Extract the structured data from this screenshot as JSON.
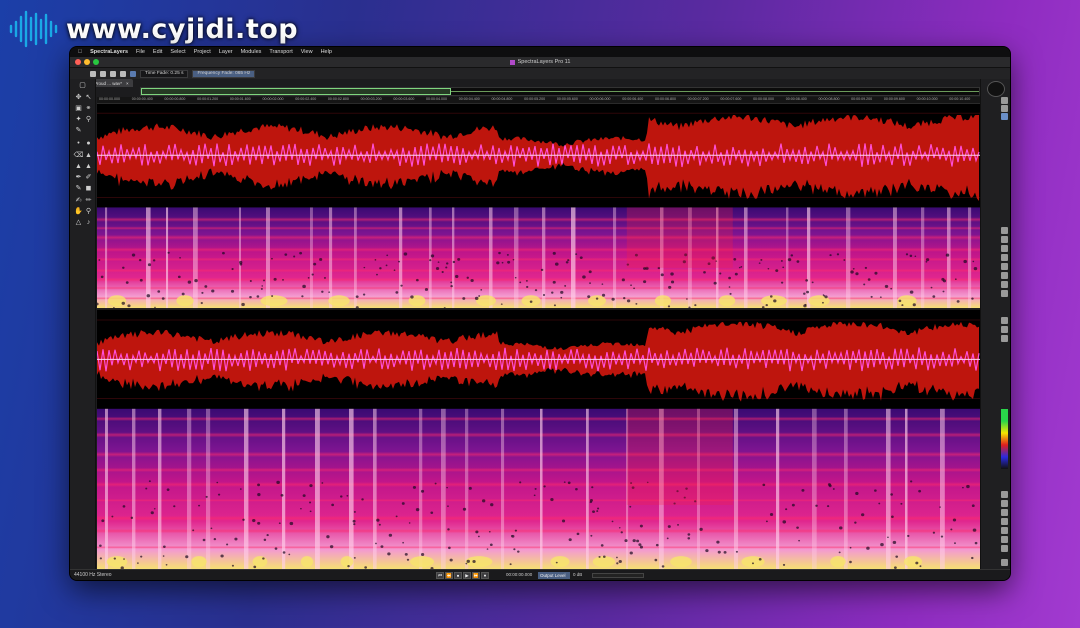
{
  "watermark": {
    "text": "www.cyjidi.top"
  },
  "menubar": {
    "app_name": "SpectraLayers",
    "items": [
      "File",
      "Edit",
      "Select",
      "Project",
      "Layer",
      "Modules",
      "Transport",
      "View",
      "Help"
    ]
  },
  "window": {
    "title": "SpectraLayers Pro 11"
  },
  "toolbar": {
    "time_fade": "Time Fade: 0.25 s",
    "frequency_fade": "Frequency Fade: 065 Hz"
  },
  "tab": {
    "label": "Proud ... wav*",
    "close": "×"
  },
  "ruler": {
    "ticks": [
      "00:00:00.000",
      "00:00:00.400",
      "00:00:00.800",
      "00:00:01.200",
      "00:00:01.600",
      "00:00:02.000",
      "00:00:02.400",
      "00:00:02.800",
      "00:00:03.200",
      "00:00:03.600",
      "00:00:04.000",
      "00:00:04.400",
      "00:00:04.800",
      "00:00:05.200",
      "00:00:05.600",
      "00:00:06.000",
      "00:00:06.400",
      "00:00:06.800",
      "00:00:07.200",
      "00:00:07.600",
      "00:00:08.000",
      "00:00:08.400",
      "00:00:08.800",
      "00:00:09.200",
      "00:00:09.600",
      "00:00:10.000",
      "00:00:10.400"
    ]
  },
  "status": {
    "format": "44100 Hz Stereo",
    "timecode": "00:00:00.000",
    "output_level_label": "Output Level",
    "output_level_value": "0 dB"
  },
  "transport": {
    "buttons": [
      "⏮",
      "⏪",
      "⏹",
      "▶",
      "⏩",
      "●"
    ]
  },
  "colors": {
    "waveform": "#c8160e",
    "waveform_core": "#ff4fd8",
    "spectro_low": "#3b0a6e",
    "spectro_mid": "#d7189a",
    "spectro_high": "#f7e66a"
  }
}
